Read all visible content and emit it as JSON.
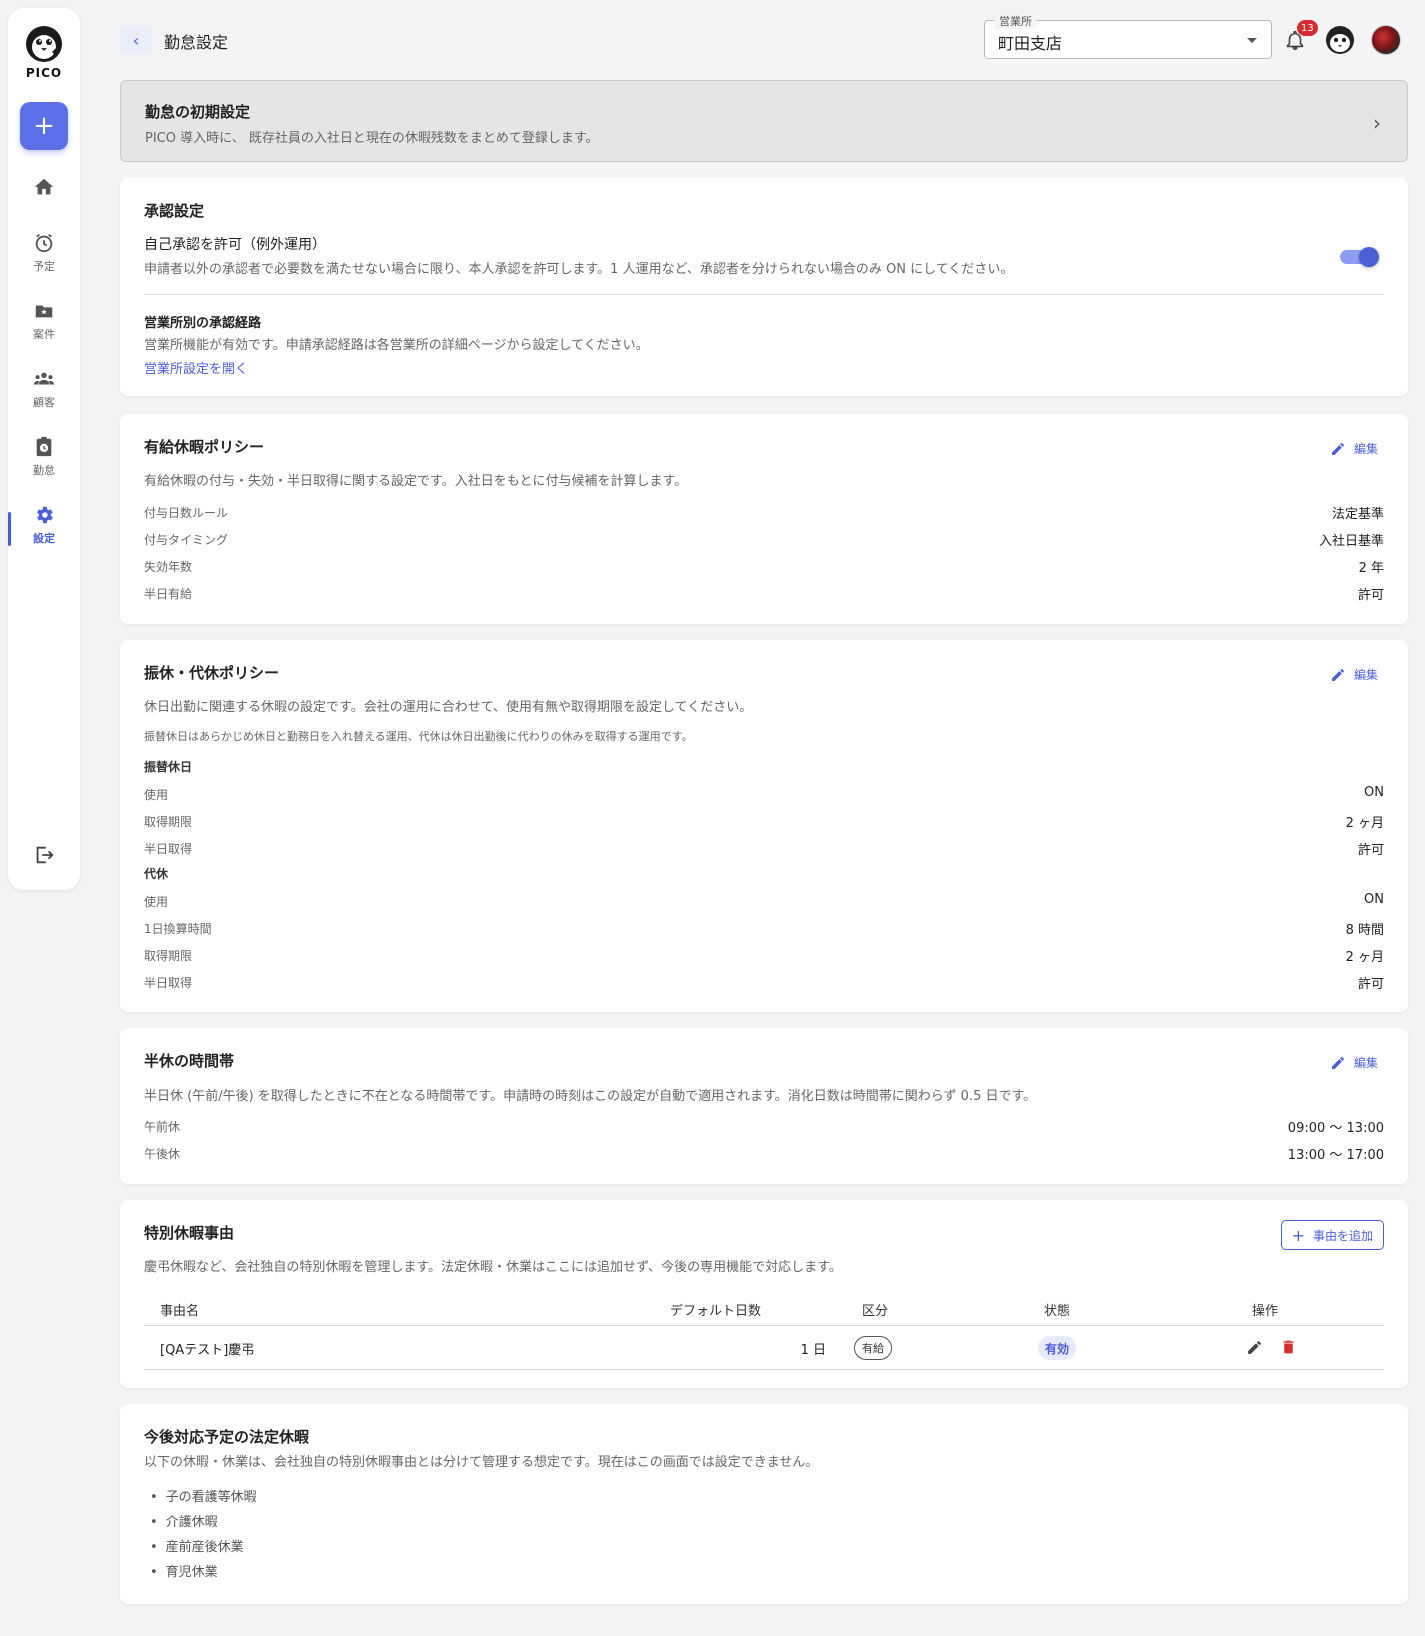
{
  "sidebar": {
    "logo_text": "PICO",
    "add_label": "+",
    "items": [
      {
        "label": ""
      },
      {
        "label": "予定"
      },
      {
        "label": "案件"
      },
      {
        "label": "顧客"
      },
      {
        "label": "勤怠"
      },
      {
        "label": "設定"
      }
    ]
  },
  "header": {
    "back_label": "‹",
    "title": "勤怠設定",
    "office_label": "営業所",
    "office_value": "町田支店",
    "notification_count": "13"
  },
  "banner": {
    "title": "勤怠の初期設定",
    "description": "PICO 導入時に、 既存社員の入社日と現在の休暇残数をまとめて登録します。",
    "chevron": "›"
  },
  "approval": {
    "title": "承認設定",
    "self_approval_label": "自己承認を許可（例外運用）",
    "self_approval_desc": "申請者以外の承認者で必要数を満たせない場合に限り、本人承認を許可します。1 人運用など、承認者を分けられない場合のみ ON にしてください。",
    "self_approval_on": true,
    "route_title": "営業所別の承認経路",
    "route_desc": "営業所機能が有効です。申請承認経路は各営業所の詳細ページから設定してください。",
    "route_link": "営業所設定を開く"
  },
  "edit_label": "編集",
  "paid_leave": {
    "title": "有給休暇ポリシー",
    "description": "有給休暇の付与・失効・半日取得に関する設定です。入社日をもとに付与候補を計算します。",
    "rows": [
      {
        "label": "付与日数ルール",
        "value": "法定基準"
      },
      {
        "label": "付与タイミング",
        "value": "入社日基準"
      },
      {
        "label": "失効年数",
        "value": "2 年"
      },
      {
        "label": "半日有給",
        "value": "許可"
      }
    ]
  },
  "substitute": {
    "title": "振休・代休ポリシー",
    "description": "休日出勤に関連する休暇の設定です。会社の運用に合わせて、使用有無や取得期限を設定してください。",
    "note": "振替休日はあらかじめ休日と勤務日を入れ替える運用、代休は休日出勤後に代わりの休みを取得する運用です。",
    "groups": [
      {
        "label": "振替休日",
        "rows": [
          {
            "label": "使用",
            "value": "ON"
          },
          {
            "label": "取得期限",
            "value": "2 ヶ月"
          },
          {
            "label": "半日取得",
            "value": "許可"
          }
        ]
      },
      {
        "label": "代休",
        "rows": [
          {
            "label": "使用",
            "value": "ON"
          },
          {
            "label": "1日換算時間",
            "value": "8 時間"
          },
          {
            "label": "取得期限",
            "value": "2 ヶ月"
          },
          {
            "label": "半日取得",
            "value": "許可"
          }
        ]
      }
    ]
  },
  "half_day": {
    "title": "半休の時間帯",
    "description": "半日休 (午前/午後) を取得したときに不在となる時間帯です。申請時の時刻はこの設定が自動で適用されます。消化日数は時間帯に関わらず 0.5 日です。",
    "rows": [
      {
        "label": "午前休",
        "value": "09:00 〜 13:00"
      },
      {
        "label": "午後休",
        "value": "13:00 〜 17:00"
      }
    ]
  },
  "special_leave": {
    "title": "特別休暇事由",
    "add_button": "事由を追加",
    "description": "慶弔休暇など、会社独自の特別休暇を管理します。法定休暇・休業はここには追加せず、今後の専用機能で対応します。",
    "columns": [
      "事由名",
      "デフォルト日数",
      "区分",
      "状態",
      "操作"
    ],
    "rows": [
      {
        "name": "[QAテスト]慶弔",
        "days": "1 日",
        "category": "有給",
        "status": "有効"
      }
    ]
  },
  "future_leave": {
    "title": "今後対応予定の法定休暇",
    "description": "以下の休暇・休業は、会社独自の特別休暇事由とは分けて管理する想定です。現在はこの画面では設定できません。",
    "items": [
      "子の看護等休暇",
      "介護休暇",
      "産前産後休業",
      "育児休業"
    ]
  },
  "colors": {
    "accent": "#4a5fd8",
    "danger": "#d62e2e",
    "badge": "#d62e2e"
  }
}
